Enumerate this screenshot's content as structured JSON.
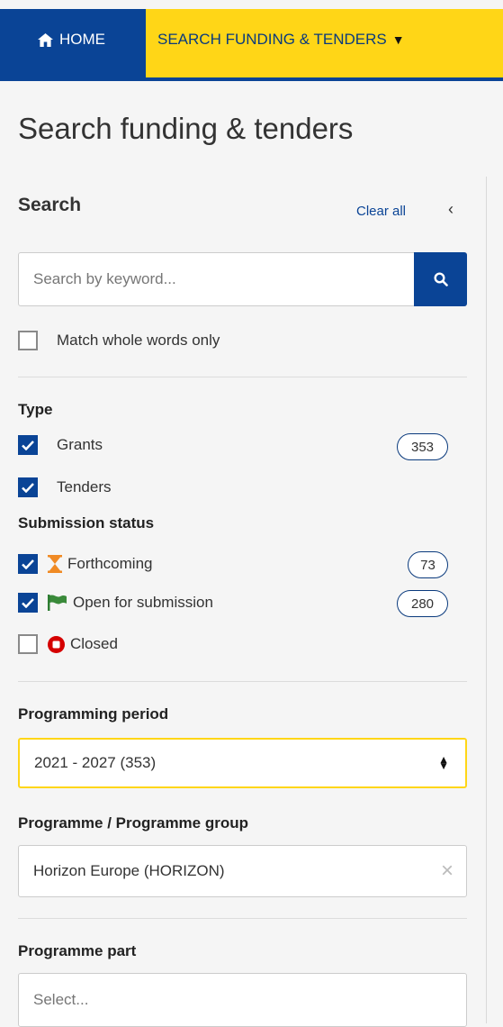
{
  "nav": {
    "home_label": "HOME",
    "search_label": "SEARCH FUNDING & TENDERS",
    "colors": {
      "primary": "#0a4496",
      "accent": "#ffd617"
    }
  },
  "page": {
    "title": "Search funding & tenders"
  },
  "search": {
    "heading": "Search",
    "clear_all": "Clear all",
    "placeholder": "Search by keyword...",
    "value": "",
    "whole_words_label": "Match whole words only",
    "whole_words_checked": false
  },
  "type": {
    "heading": "Type",
    "options": [
      {
        "label": "Grants",
        "checked": true,
        "count": "353"
      },
      {
        "label": "Tenders",
        "checked": true,
        "count": ""
      }
    ]
  },
  "submission_status": {
    "heading": "Submission status",
    "options": [
      {
        "label": "Forthcoming",
        "checked": true,
        "count": "73",
        "icon": "hourglass-icon"
      },
      {
        "label": "Open for submission",
        "checked": true,
        "count": "280",
        "icon": "flag-icon"
      },
      {
        "label": "Closed",
        "checked": false,
        "count": "",
        "icon": "stop-icon"
      }
    ]
  },
  "programming_period": {
    "heading": "Programming period",
    "selected": "2021 - 2027 (353)"
  },
  "programme": {
    "heading": "Programme / Programme group",
    "selected": "Horizon Europe (HORIZON)"
  },
  "programme_part": {
    "heading": "Programme part",
    "placeholder": "Select..."
  }
}
